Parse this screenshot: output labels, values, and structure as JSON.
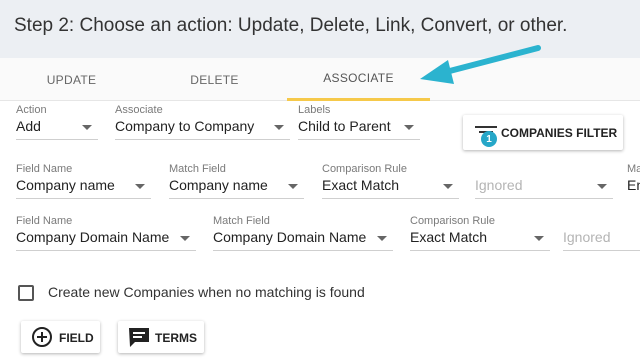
{
  "header": {
    "title": "Step 2: Choose an action: Update, Delete, Link, Convert, or other."
  },
  "tabs": [
    {
      "label": "UPDATE",
      "active": false
    },
    {
      "label": "DELETE",
      "active": false
    },
    {
      "label": "ASSOCIATE",
      "active": true
    }
  ],
  "row1": {
    "action": {
      "label": "Action",
      "value": "Add"
    },
    "associate": {
      "label": "Associate",
      "value": "Company to Company"
    },
    "labels": {
      "label": "Labels",
      "value": "Child to Parent"
    },
    "filter_button": {
      "label": "COMPANIES FILTER",
      "badge": "1"
    }
  },
  "row2": {
    "field_name": {
      "label": "Field Name",
      "value": "Company name"
    },
    "match_field": {
      "label": "Match Field",
      "value": "Company name"
    },
    "comparison_rule": {
      "label": "Comparison Rule",
      "value": "Exact Match"
    },
    "modifier": {
      "value": "Ignored"
    },
    "extra": {
      "label": "Ma",
      "value": "En"
    }
  },
  "row3": {
    "field_name": {
      "label": "Field Name",
      "value": "Company Domain Name"
    },
    "match_field": {
      "label": "Match Field",
      "value": "Company Domain Name"
    },
    "comparison_rule": {
      "label": "Comparison Rule",
      "value": "Exact Match"
    },
    "modifier": {
      "value": "Ignored"
    }
  },
  "create_new": {
    "label": "Create new Companies when no matching is found",
    "checked": false
  },
  "buttons": {
    "field": "FIELD",
    "terms": "TERMS"
  },
  "colors": {
    "accent_underline": "#f6c94a",
    "arrow": "#2bb3cf",
    "badge": "#26a7c8",
    "header_bg": "#eceff3"
  },
  "icons": [
    "arrow-pointer-icon",
    "filter-icon",
    "add-circle-icon",
    "message-icon",
    "caret-down-icon"
  ]
}
